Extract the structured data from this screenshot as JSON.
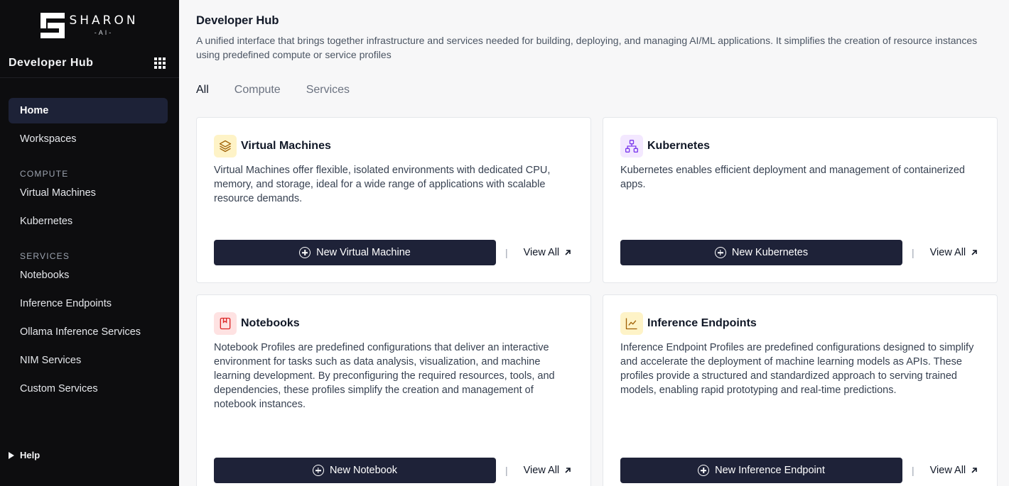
{
  "sidebar": {
    "logo": {
      "name": "SHARON",
      "sub": "-AI-"
    },
    "title": "Developer Hub",
    "items_top": [
      {
        "label": "Home",
        "active": true
      },
      {
        "label": "Workspaces",
        "active": false
      }
    ],
    "compute_header": "COMPUTE",
    "compute_items": [
      {
        "label": "Virtual Machines"
      },
      {
        "label": "Kubernetes"
      }
    ],
    "services_header": "SERVICES",
    "services_items": [
      {
        "label": "Notebooks"
      },
      {
        "label": "Inference Endpoints"
      },
      {
        "label": "Ollama Inference Services"
      },
      {
        "label": "NIM Services"
      },
      {
        "label": "Custom Services"
      }
    ],
    "help_label": "Help"
  },
  "header": {
    "title": "Developer Hub",
    "description": "A unified interface that brings together infrastructure and services needed for building, deploying, and managing AI/ML applications. It simplifies the creation of resource instances using predefined compute or service profiles"
  },
  "tabs": [
    {
      "label": "All",
      "active": true
    },
    {
      "label": "Compute",
      "active": false
    },
    {
      "label": "Services",
      "active": false
    }
  ],
  "cards": [
    {
      "title": "Virtual Machines",
      "icon": "layers-icon",
      "icon_color": "#a16207",
      "icon_bg": "#fef3c7",
      "description": "Virtual Machines offer flexible, isolated environments with dedicated CPU, memory, and storage, ideal for a wide range of applications with scalable resource demands.",
      "button_label": "New Virtual Machine",
      "link_label": "View All"
    },
    {
      "title": "Kubernetes",
      "icon": "network-icon",
      "icon_color": "#7c3aed",
      "icon_bg": "#f3e8ff",
      "description": "Kubernetes enables efficient deployment and management of containerized apps.",
      "button_label": "New Kubernetes",
      "link_label": "View All"
    },
    {
      "title": "Notebooks",
      "icon": "notebook-icon",
      "icon_color": "#dc2626",
      "icon_bg": "#fee2e2",
      "description": "Notebook Profiles are predefined configurations that deliver an interactive environment for tasks such as data analysis, visualization, and machine learning development. By preconfiguring the required resources, tools, and dependencies, these profiles simplify the creation and management of notebook instances.",
      "button_label": "New Notebook",
      "link_label": "View All"
    },
    {
      "title": "Inference Endpoints",
      "icon": "chart-line-icon",
      "icon_color": "#a16207",
      "icon_bg": "#fef3c7",
      "description": "Inference Endpoint Profiles are predefined configurations designed to simplify and accelerate the deployment of machine learning models as APIs. These profiles provide a structured and standardized approach to serving trained models, enabling rapid prototyping and real-time predictions.",
      "button_label": "New Inference Endpoint",
      "link_label": "View All"
    }
  ]
}
